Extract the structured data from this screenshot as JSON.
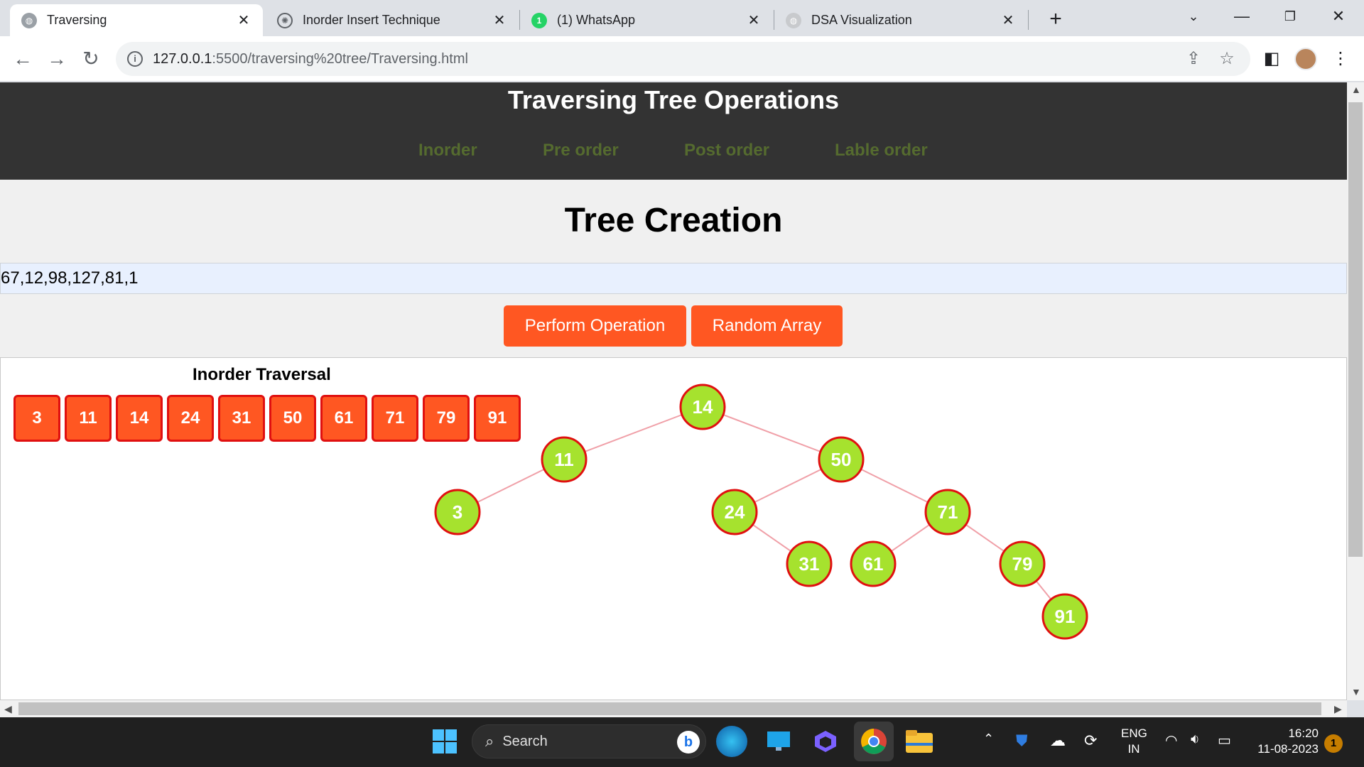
{
  "browser": {
    "tabs": [
      {
        "title": "Traversing",
        "icon": "globe-icon",
        "active": true
      },
      {
        "title": "Inorder Insert Technique",
        "icon": "chatgpt-icon",
        "active": false
      },
      {
        "title": "(1) WhatsApp",
        "icon": "whatsapp-icon",
        "active": false,
        "badge": "1"
      },
      {
        "title": "DSA Visualization",
        "icon": "globe-icon",
        "active": false
      }
    ],
    "url_host": "127.0.0.1",
    "url_path": ":5500/traversing%20tree/Traversing.html"
  },
  "page": {
    "site_title": "Traversing Tree Operations",
    "nav": [
      "Inorder",
      "Pre order",
      "Post order",
      "Lable order"
    ],
    "section_title": "Tree Creation",
    "array_input_value": "67,12,98,127,81,1",
    "buttons": {
      "perform": "Perform Operation",
      "random": "Random Array"
    },
    "traversal_title": "Inorder Traversal",
    "traversal_values": [
      "3",
      "11",
      "14",
      "24",
      "31",
      "50",
      "61",
      "71",
      "79",
      "91"
    ],
    "tree": {
      "nodes": [
        "14",
        "11",
        "50",
        "3",
        "24",
        "71",
        "31",
        "61",
        "79",
        "91"
      ],
      "edges": [
        [
          "14",
          "11"
        ],
        [
          "14",
          "50"
        ],
        [
          "11",
          "3"
        ],
        [
          "50",
          "24"
        ],
        [
          "50",
          "71"
        ],
        [
          "24",
          "31"
        ],
        [
          "71",
          "61"
        ],
        [
          "71",
          "79"
        ],
        [
          "79",
          "91"
        ]
      ]
    },
    "colors": {
      "header_bg": "#333333",
      "nav_text": "#556b2f",
      "button": "#ff5722",
      "node_fill": "#a6e22e",
      "node_border": "#e01010"
    }
  },
  "taskbar": {
    "search_placeholder": "Search",
    "lang_top": "ENG",
    "lang_bottom": "IN",
    "time": "16:20",
    "date": "11-08-2023",
    "notification_count": "1"
  }
}
